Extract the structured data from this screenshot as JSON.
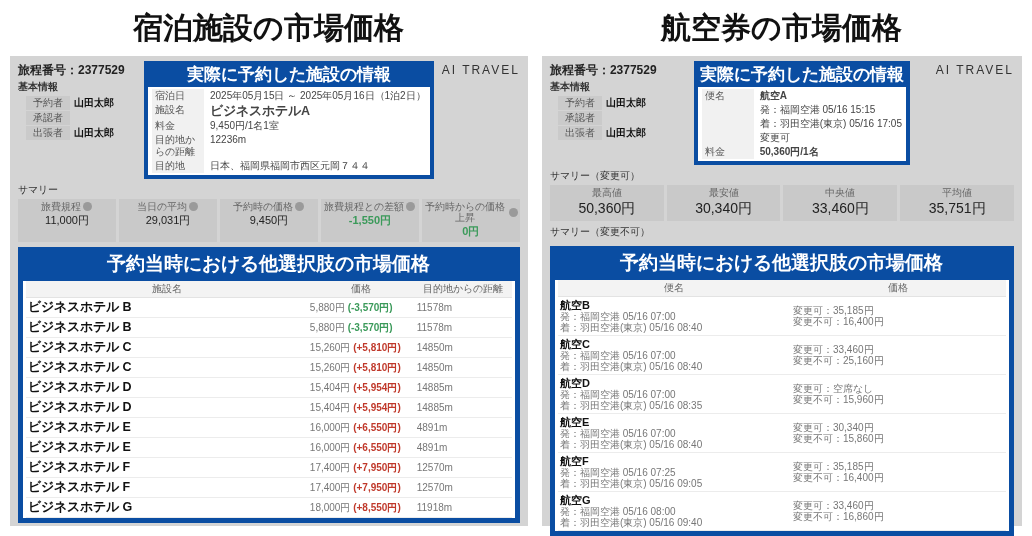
{
  "panels": [
    {
      "kind": "hotel",
      "headline": "宿泊施設の市場価格",
      "itinerary": "旅程番号：2377529",
      "basic_info": "基本情報",
      "people": [
        {
          "label": "予約者",
          "value": "山田太郎"
        },
        {
          "label": "承認者"
        },
        {
          "label": "出張者",
          "value": "山田太郎"
        }
      ],
      "callout": {
        "title": "実際に予約した施設の情報",
        "rows": [
          {
            "label": "宿泊日",
            "lines": [
              "2025年05月15日 ～ 2025年05月16日（1泊2日）"
            ]
          },
          {
            "label": "施設名",
            "lines": [
              "ビジネスホテルA"
            ],
            "bold": true
          },
          {
            "label": "料金",
            "lines": [
              "9,450円/1名1室"
            ]
          },
          {
            "label": "目的地からの距離",
            "lines": [
              "12236m"
            ]
          },
          {
            "label": "目的地",
            "lines": [
              "日本、福岡県福岡市西区元岡７４４"
            ]
          }
        ]
      },
      "logo": "AI TRAVEL",
      "summaries": [
        {
          "label": "サマリー",
          "cards": [
            {
              "label": "旅費規程",
              "value": "11,000円",
              "help": true
            },
            {
              "label": "当日の平均",
              "value": "29,031円",
              "help": true
            },
            {
              "label": "予約時の価格",
              "value": "9,450円",
              "help": true
            },
            {
              "label": "旅費規程との差額",
              "value": "-1,550円",
              "help": true,
              "color": "#3b9a5a"
            },
            {
              "label": "予約時からの価格上昇",
              "value": "0円",
              "help": true,
              "color": "#3b9a5a"
            }
          ]
        }
      ],
      "market": {
        "title": "予約当時における他選択肢の市場価格",
        "columns": [
          "施設名",
          "価格",
          "目的地からの距離"
        ],
        "rows": [
          {
            "name": "ビジネスホテル B",
            "price": "5,880円",
            "diff": "(-3,570円)",
            "color": "#3b9a5a",
            "distance": "11578m"
          },
          {
            "name": "ビジネスホテル B",
            "price": "5,880円",
            "diff": "(-3,570円)",
            "color": "#3b9a5a",
            "distance": "11578m"
          },
          {
            "name": "ビジネスホテル C",
            "price": "15,260円",
            "diff": "(+5,810円)",
            "color": "#c0392b",
            "distance": "14850m"
          },
          {
            "name": "ビジネスホテル C",
            "price": "15,260円",
            "diff": "(+5,810円)",
            "color": "#c0392b",
            "distance": "14850m"
          },
          {
            "name": "ビジネスホテル D",
            "price": "15,404円",
            "diff": "(+5,954円)",
            "color": "#c0392b",
            "distance": "14885m"
          },
          {
            "name": "ビジネスホテル D",
            "price": "15,404円",
            "diff": "(+5,954円)",
            "color": "#c0392b",
            "distance": "14885m"
          },
          {
            "name": "ビジネスホテル E",
            "price": "16,000円",
            "diff": "(+6,550円)",
            "color": "#c0392b",
            "distance": "4891m"
          },
          {
            "name": "ビジネスホテル E",
            "price": "16,000円",
            "diff": "(+6,550円)",
            "color": "#c0392b",
            "distance": "4891m"
          },
          {
            "name": "ビジネスホテル F",
            "price": "17,400円",
            "diff": "(+7,950円)",
            "color": "#c0392b",
            "distance": "12570m"
          },
          {
            "name": "ビジネスホテル F",
            "price": "17,400円",
            "diff": "(+7,950円)",
            "color": "#c0392b",
            "distance": "12570m"
          },
          {
            "name": "ビジネスホテル G",
            "price": "18,000円",
            "diff": "(+8,550円)",
            "color": "#c0392b",
            "distance": "11918m"
          }
        ]
      }
    },
    {
      "kind": "flight",
      "headline": "航空券の市場価格",
      "itinerary": "旅程番号：2377529",
      "basic_info": "基本情報",
      "people": [
        {
          "label": "予約者",
          "value": "山田太郎"
        },
        {
          "label": "承認者"
        },
        {
          "label": "出張者",
          "value": "山田太郎"
        }
      ],
      "callout": {
        "title": "実際に予約した施設の情報",
        "rows": [
          {
            "label": "便名",
            "lines": [
              "航空A",
              "発：福岡空港 05/16 15:15",
              "着：羽田空港(東京) 05/16 17:05",
              "変更可"
            ]
          },
          {
            "label": "料金",
            "lines": [
              "50,360円/1名"
            ]
          }
        ]
      },
      "logo": "AI TRAVEL",
      "summaries": [
        {
          "label": "サマリー（変更可）",
          "cards": [
            {
              "label": "最高値",
              "value": "50,360円"
            },
            {
              "label": "最安値",
              "value": "30,340円"
            },
            {
              "label": "中央値",
              "value": "33,460円"
            },
            {
              "label": "平均値",
              "value": "35,751円"
            }
          ]
        },
        {
          "label": "サマリー（変更不可）"
        }
      ],
      "market": {
        "title": "予約当時における他選択肢の市場価格",
        "columns": [
          "便名",
          "価格"
        ],
        "rows": [
          {
            "name": "航空B",
            "departure": "発：福岡空港 05/16 07:00",
            "arrival": "着：羽田空港(東京) 05/16 08:40",
            "prices": [
              "変更可：35,185円",
              "変更不可：16,400円"
            ]
          },
          {
            "name": "航空C",
            "departure": "発：福岡空港 05/16 07:00",
            "arrival": "着：羽田空港(東京) 05/16 08:40",
            "prices": [
              "変更可：33,460円",
              "変更不可：25,160円"
            ]
          },
          {
            "name": "航空D",
            "departure": "発：福岡空港 05/16 07:00",
            "arrival": "着：羽田空港(東京) 05/16 08:35",
            "prices": [
              "変更可：空席なし",
              "変更不可：15,960円"
            ]
          },
          {
            "name": "航空E",
            "departure": "発：福岡空港 05/16 07:00",
            "arrival": "着：羽田空港(東京) 05/16 08:40",
            "prices": [
              "変更可：30,340円",
              "変更不可：15,860円"
            ]
          },
          {
            "name": "航空F",
            "departure": "発：福岡空港 05/16 07:25",
            "arrival": "着：羽田空港(東京) 05/16 09:05",
            "prices": [
              "変更可：35,185円",
              "変更不可：16,400円"
            ]
          },
          {
            "name": "航空G",
            "departure": "発：福岡空港 05/16 08:00",
            "arrival": "着：羽田空港(東京) 05/16 09:40",
            "prices": [
              "変更可：33,460円",
              "変更不可：16,860円"
            ]
          }
        ]
      }
    }
  ]
}
